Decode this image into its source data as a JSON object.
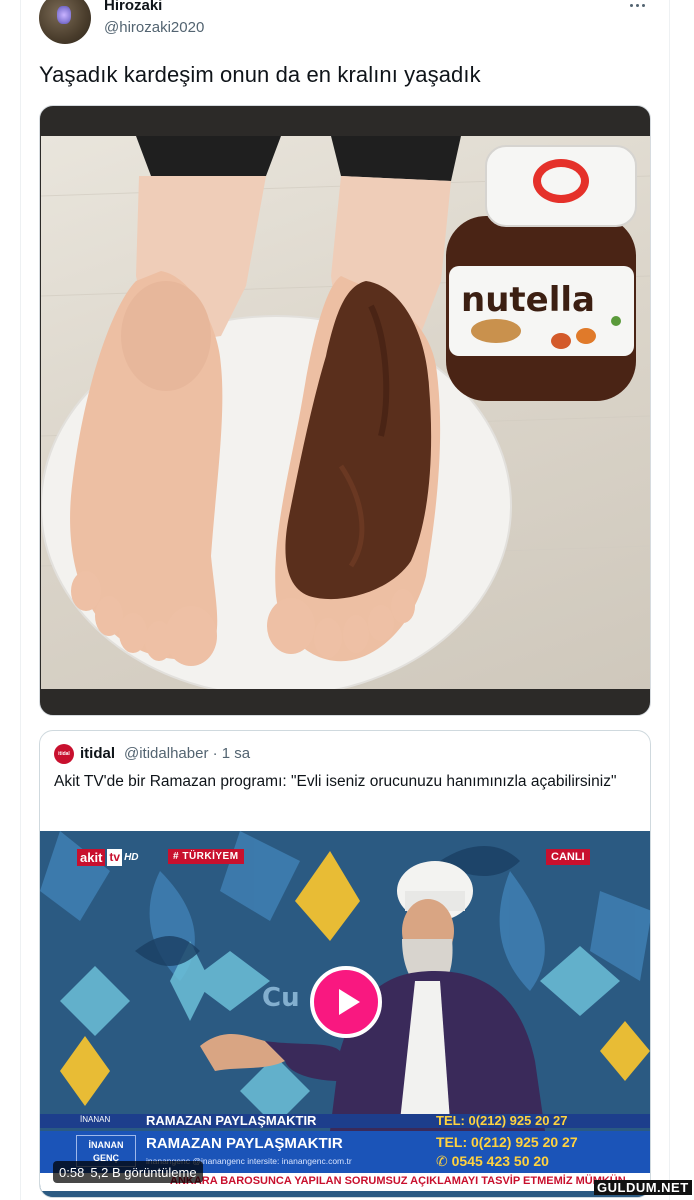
{
  "tweet": {
    "display_name": "Hirozaki",
    "handle": "@hirozaki2020",
    "text": "Yaşadık kardeşim onun da en kralını yaşadık"
  },
  "main_image": {
    "jar_label": "nutella"
  },
  "quoted_tweet": {
    "avatar_text": "itidal",
    "name": "itidal",
    "handle_time": "@itidalhaber · 1 sa",
    "text": "Akit TV'de bir Ramazan programı: \"Evli iseniz orucunuzu hanımınızla açabilirsiniz\""
  },
  "video": {
    "channel_logo_1": "akit",
    "channel_logo_2": "tv",
    "channel_logo_3": "HD",
    "hashtag": "# TÜRKİYEM",
    "live_label": "CANLI",
    "ticker_top_left": "İNANAN",
    "ticker_top_title": "RAMAZAN PAYLAŞMAKTIR",
    "ticker_top_tel": "TEL: 0(212) 925 20 27",
    "lower_third_box": "İNANAN GENÇ",
    "lower_third_title": "RAMAZAN PAYLAŞMAKTIR",
    "lower_third_sub": "inanangenc   @inanangenc   intersite: inanangenc.com.tr",
    "lower_third_tel": "TEL: 0(212) 925 20 27",
    "lower_third_whatsapp": "0545 423 50 20",
    "ticker_bottom": "ANKARA BAROSUNCA YAPILAN SORUMSUZ AÇIKLAMAYI TASVİP ETMEMİZ MÜMKÜN",
    "duration": "0:58",
    "views": "5,2 B görüntüleme",
    "background_text": "Cu"
  },
  "watermark": "GULDUM.NET",
  "colors": {
    "play_button": "#f91880",
    "akit_red": "#c8102e",
    "lower_third_blue": "#1b54b8"
  }
}
